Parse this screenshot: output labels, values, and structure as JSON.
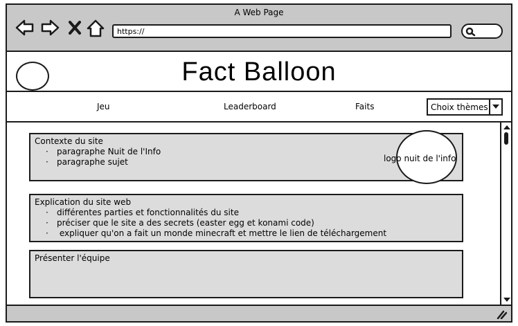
{
  "browser": {
    "window_title": "A Web Page",
    "url": "https://",
    "icons": [
      "back-icon",
      "forward-icon",
      "close-icon",
      "home-icon",
      "search-icon"
    ]
  },
  "header": {
    "site_title": "Fact Balloon"
  },
  "nav": {
    "links": [
      "Jeu",
      "Leaderboard",
      "Faits"
    ],
    "theme_select": "Choix thèmes"
  },
  "sections": [
    {
      "title": "Contexte du site",
      "items": [
        "paragraphe Nuit de l'Info",
        "paragraphe sujet"
      ],
      "logo_label": "logo nuit de l'info"
    },
    {
      "title": "Explication du site web",
      "items": [
        "différentes parties et fonctionnalités du site",
        "préciser que le site a des secrets (easter egg et konami code)",
        " expliquer qu'on a fait un monde minecraft et mettre le lien de téléchargement"
      ]
    },
    {
      "title": "Présenter l'équipe",
      "items": []
    }
  ],
  "colors": {
    "chrome": "#c8c8c8",
    "panel": "#dcdcdc",
    "stroke": "#1a1a1a"
  }
}
